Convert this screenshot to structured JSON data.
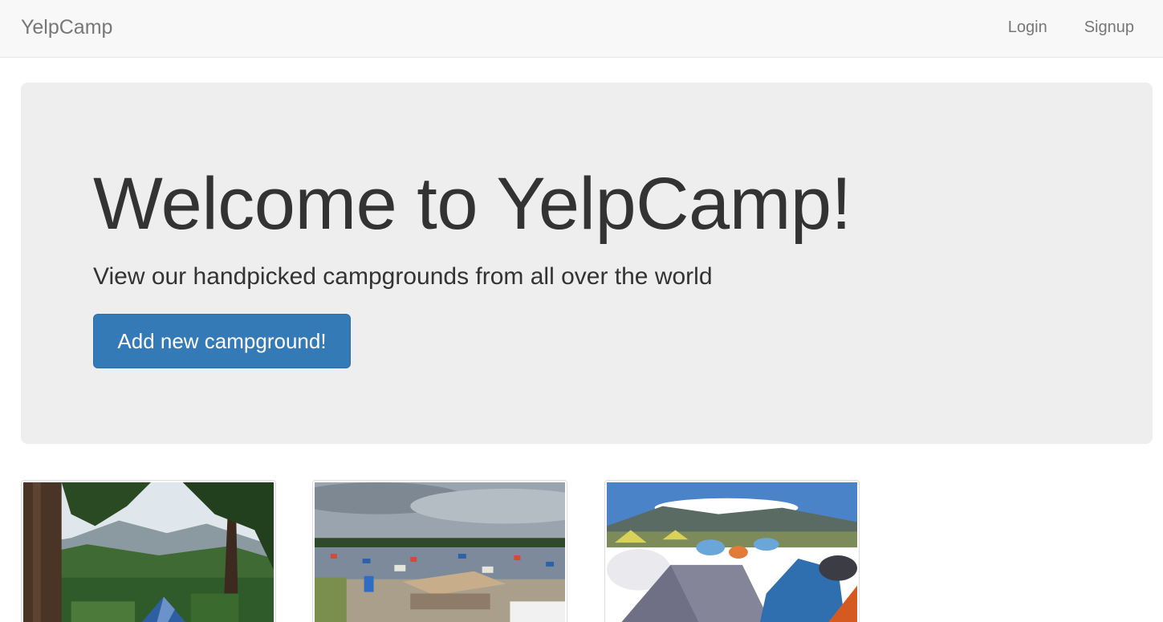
{
  "navbar": {
    "brand": "YelpCamp",
    "links": [
      {
        "label": "Login"
      },
      {
        "label": "Signup"
      }
    ]
  },
  "jumbotron": {
    "title": "Welcome to YelpCamp!",
    "subtitle": "View our handpicked campgrounds from all over the world",
    "button_label": "Add new campground!"
  },
  "colors": {
    "primary": "#337ab7",
    "navbar_bg": "#f8f8f8",
    "jumbotron_bg": "#eeeeee"
  }
}
